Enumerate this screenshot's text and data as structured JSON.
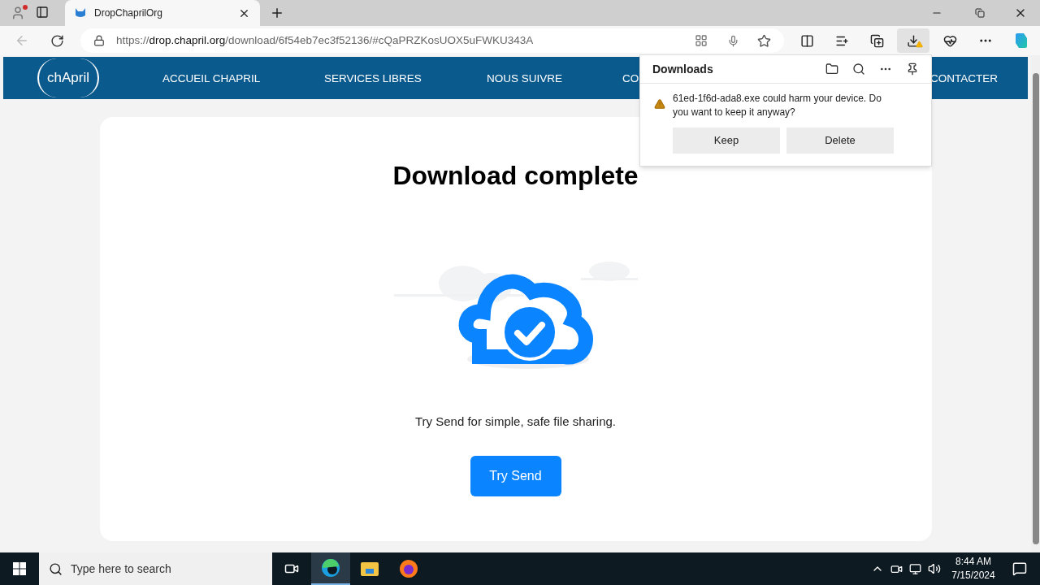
{
  "browser": {
    "tab": {
      "title": "DropChaprilOrg",
      "selected": true
    },
    "address": {
      "scheme": "https://",
      "host": "drop.chapril.org",
      "path": "/download/6f54eb7ec3f52136/#cQaPRZKosUOX5uFWKU343A"
    }
  },
  "site": {
    "logo": "chApril",
    "nav": [
      {
        "label": "ACCUEIL CHAPRIL"
      },
      {
        "label": "SERVICES LIBRES"
      },
      {
        "label": "NOUS SUIVRE"
      },
      {
        "label": "CO"
      },
      {
        "label": "CONTACTER"
      }
    ],
    "heading": "Download complete",
    "message": "Try Send for simple, safe file sharing.",
    "button": "Try Send"
  },
  "downloads": {
    "title": "Downloads",
    "warning": "61ed-1f6d-ada8.exe could harm your device. Do you want to keep it anyway?",
    "buttons": [
      "Keep",
      "Delete"
    ]
  },
  "taskbar": {
    "search_placeholder": "Type here to search",
    "time": "8:44 AM",
    "date": "7/15/2024"
  }
}
